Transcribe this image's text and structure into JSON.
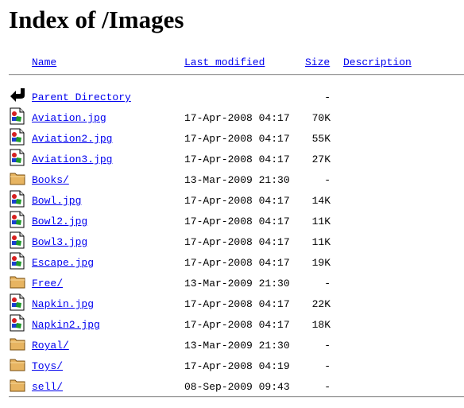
{
  "page_title": "Index of /Images",
  "columns": {
    "name": "Name",
    "last_modified": "Last modified",
    "size": "Size",
    "description": "Description"
  },
  "parent": {
    "name": "Parent Directory",
    "date": "",
    "size": "-",
    "icon": "back-icon"
  },
  "entries": [
    {
      "name": "Aviation.jpg",
      "date": "17-Apr-2008 04:17",
      "size": "70K",
      "icon": "image-file-icon"
    },
    {
      "name": "Aviation2.jpg",
      "date": "17-Apr-2008 04:17",
      "size": "55K",
      "icon": "image-file-icon"
    },
    {
      "name": "Aviation3.jpg",
      "date": "17-Apr-2008 04:17",
      "size": "27K",
      "icon": "image-file-icon"
    },
    {
      "name": "Books/",
      "date": "13-Mar-2009 21:30",
      "size": "-",
      "icon": "folder-icon"
    },
    {
      "name": "Bowl.jpg",
      "date": "17-Apr-2008 04:17",
      "size": "14K",
      "icon": "image-file-icon"
    },
    {
      "name": "Bowl2.jpg",
      "date": "17-Apr-2008 04:17",
      "size": "11K",
      "icon": "image-file-icon"
    },
    {
      "name": "Bowl3.jpg",
      "date": "17-Apr-2008 04:17",
      "size": "11K",
      "icon": "image-file-icon"
    },
    {
      "name": "Escape.jpg",
      "date": "17-Apr-2008 04:17",
      "size": "19K",
      "icon": "image-file-icon"
    },
    {
      "name": "Free/",
      "date": "13-Mar-2009 21:30",
      "size": "-",
      "icon": "folder-icon"
    },
    {
      "name": "Napkin.jpg",
      "date": "17-Apr-2008 04:17",
      "size": "22K",
      "icon": "image-file-icon"
    },
    {
      "name": "Napkin2.jpg",
      "date": "17-Apr-2008 04:17",
      "size": "18K",
      "icon": "image-file-icon"
    },
    {
      "name": "Royal/",
      "date": "13-Mar-2009 21:30",
      "size": "-",
      "icon": "folder-icon"
    },
    {
      "name": "Toys/",
      "date": "17-Apr-2008 04:19",
      "size": "-",
      "icon": "folder-icon"
    },
    {
      "name": "sell/",
      "date": "08-Sep-2009 09:43",
      "size": "-",
      "icon": "folder-icon"
    }
  ],
  "colors": {
    "link": "#0000ee",
    "text": "#000000",
    "rule": "#9a9a9a",
    "background": "#ffffff"
  }
}
